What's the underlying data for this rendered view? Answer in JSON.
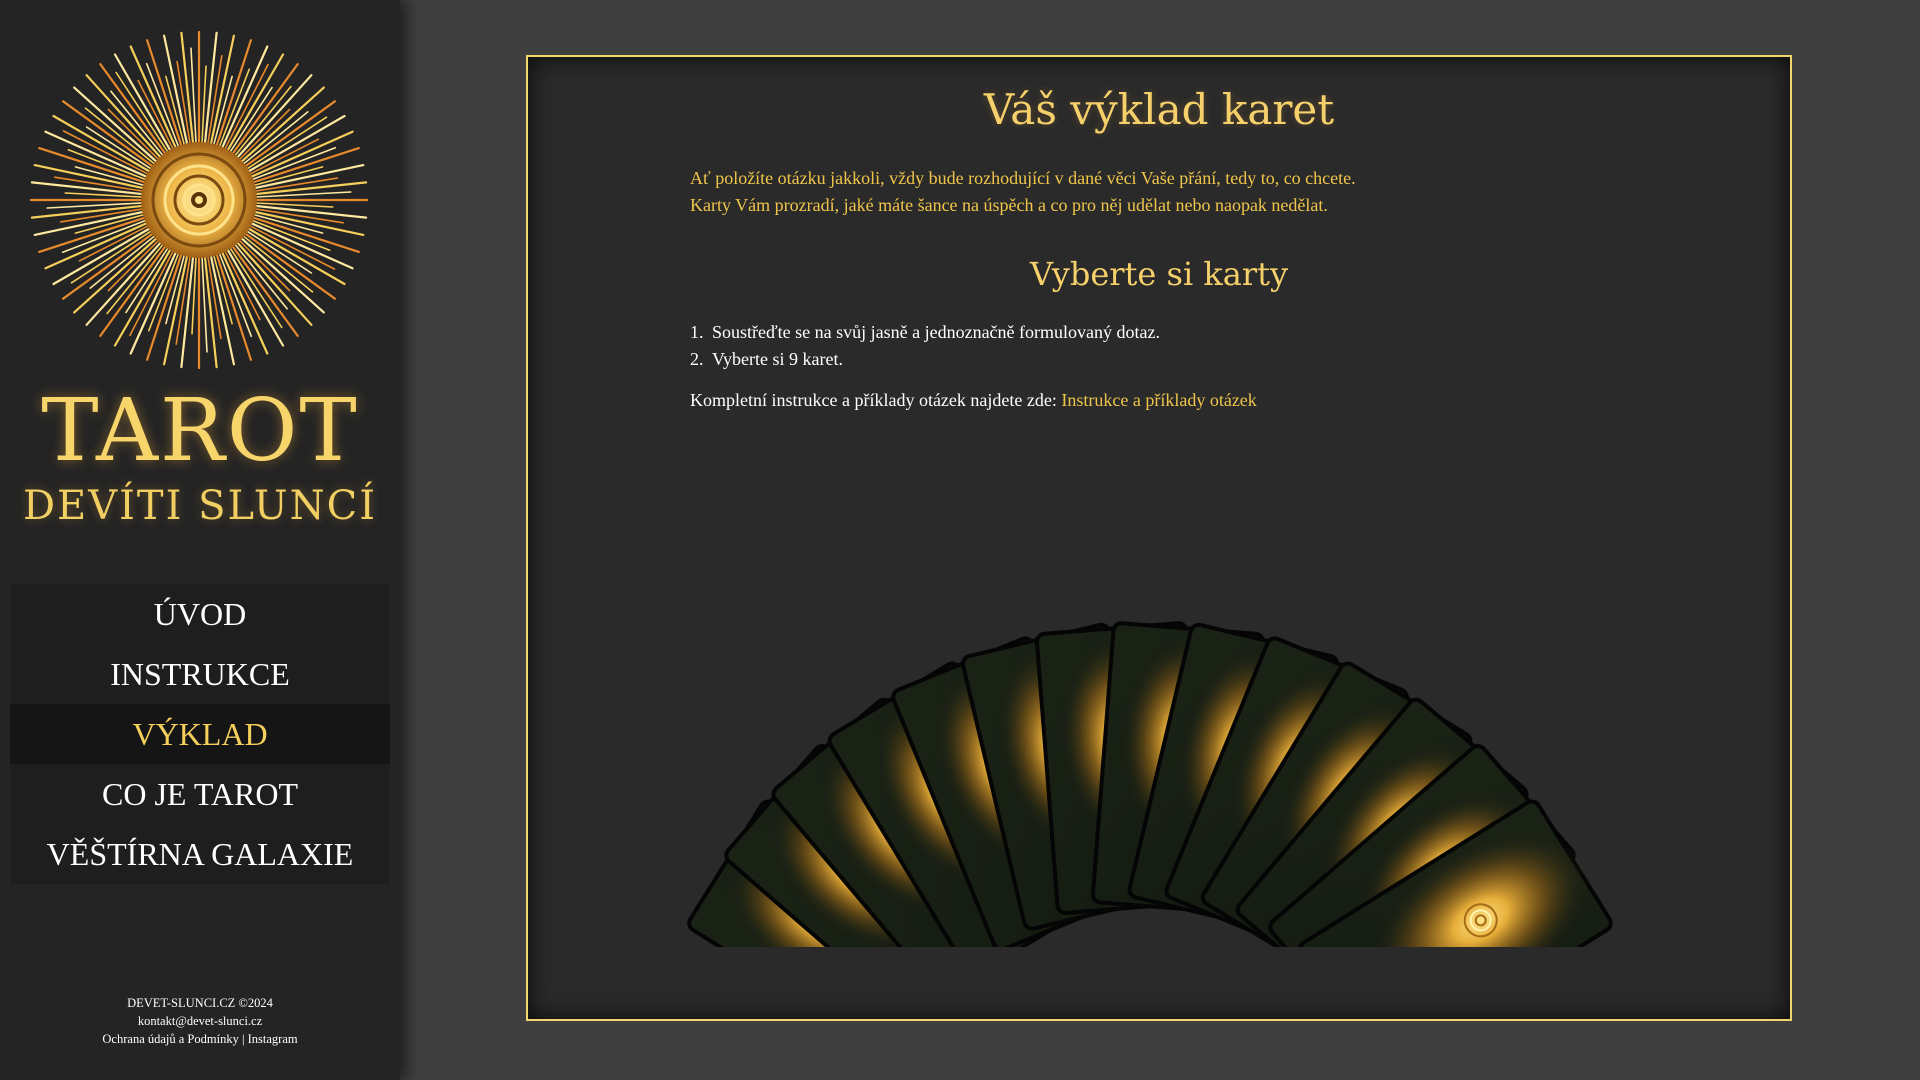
{
  "sidebar": {
    "logo_icon": "sun-mandala-icon",
    "title": "TAROT",
    "subtitle": "DEVÍTI SLUNCÍ",
    "nav": [
      {
        "label": "ÚVOD",
        "active": false
      },
      {
        "label": "INSTRUKCE",
        "active": false
      },
      {
        "label": "VÝKLAD",
        "active": true
      },
      {
        "label": "CO JE TAROT",
        "active": false
      },
      {
        "label": "VĚŠTÍRNA GALAXIE",
        "active": false
      }
    ],
    "footer": {
      "copyright": "DEVET-SLUNCI.CZ ©2024",
      "email": "kontakt@devet-slunci.cz",
      "privacy_label": "Ochrana údajů a Podmínky",
      "separator": "|",
      "instagram_label": "Instagram"
    }
  },
  "main": {
    "title": "Váš výklad karet",
    "intro_line1": "Ať položíte otázku jakkoli, vždy bude rozhodující v dané věci Vaše přání, tedy to, co chcete.",
    "intro_line2": "Karty Vám prozradí, jaké máte šance na úspěch a co pro něj udělat nebo naopak nedělat.",
    "section_title": "Vyberte si karty",
    "steps": [
      {
        "num": "1.",
        "text": "Soustřeďte se na svůj jasně a jednoznačně formulovaný dotaz."
      },
      {
        "num": "2.",
        "text": "Vyberte si 9 karet."
      }
    ],
    "more_text": "Kompletní instrukce a příklady otázek najdete zde:",
    "more_link": "Instrukce a příklady otázek",
    "cards": {
      "count": 14,
      "back_icon": "card-back-sun-icon"
    }
  },
  "colors": {
    "accent": "#f6d06a",
    "accent_text": "#f0c64a",
    "panel_bg": "#2a2a2a",
    "page_bg": "#3f3f3f",
    "sidebar_bg": "#242424",
    "panel_border": "#f2d56c"
  }
}
